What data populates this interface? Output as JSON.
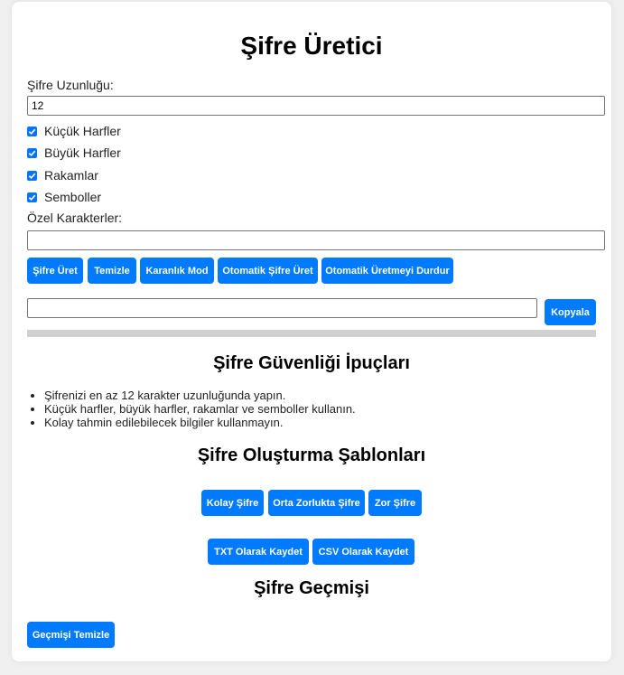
{
  "app": {
    "title": "Şifre Üretici"
  },
  "length": {
    "label": "Şifre Uzunluğu:",
    "value": "12"
  },
  "options": [
    {
      "label": "Küçük Harfler",
      "checked": true
    },
    {
      "label": "Büyük Harfler",
      "checked": true
    },
    {
      "label": "Rakamlar",
      "checked": true
    },
    {
      "label": "Semboller",
      "checked": true
    }
  ],
  "custom_chars": {
    "label": "Özel Karakterler:",
    "value": ""
  },
  "toolbar": {
    "generate": "Şifre Üret",
    "clear": "Temizle",
    "dark_mode": "Karanlık Mod",
    "auto_generate": "Otomatik Şifre Üret",
    "stop_auto": "Otomatik Üretmeyi Durdur"
  },
  "output": {
    "value": "",
    "copy": "Kopyala"
  },
  "strength": {
    "level": 0
  },
  "tips": {
    "title": "Şifre Güvenliği İpuçları",
    "items": [
      "Şifrenizi en az 12 karakter uzunluğunda yapın.",
      "Küçük harfler, büyük harfler, rakamlar ve semboller kullanın.",
      "Kolay tahmin edilebilecek bilgiler kullanmayın."
    ]
  },
  "templates": {
    "title": "Şifre Oluşturma Şablonları",
    "easy": "Kolay Şifre",
    "medium": "Orta Zorlukta Şifre",
    "hard": "Zor Şifre"
  },
  "export": {
    "txt": "TXT Olarak Kaydet",
    "csv": "CSV Olarak Kaydet"
  },
  "history": {
    "title": "Şifre Geçmişi",
    "clear": "Geçmişi Temizle"
  },
  "colors": {
    "accent": "#007bff",
    "checkbox": "#0075ff",
    "bar": "#d0d0d0"
  }
}
